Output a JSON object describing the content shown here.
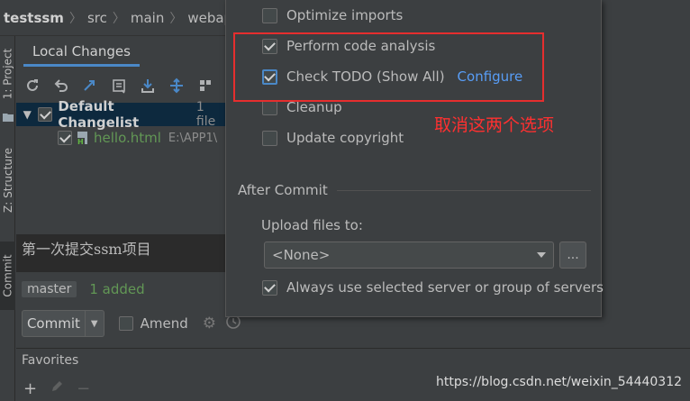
{
  "breadcrumb": [
    "testssm",
    "src",
    "main",
    "webapp"
  ],
  "side_tabs": {
    "project": "1: Project",
    "structure": "Z: Structure",
    "commit": "Commit"
  },
  "commit_panel": {
    "tab": "Local Changes",
    "changelist": {
      "name": "Default Changelist",
      "count": "1 file"
    },
    "file": {
      "name": "hello.html",
      "path": "E:\\APP1\\"
    },
    "message": "第一次提交ssm项目",
    "branch": "master",
    "added": "1 added",
    "commit_label": "Commit",
    "amend_label": "Amend"
  },
  "popup": {
    "options": [
      {
        "label": "Optimize imports",
        "checked": false
      },
      {
        "label": "Perform code analysis",
        "checked": true
      },
      {
        "label": "Check TODO (Show All)",
        "checked": true,
        "link": "Configure"
      },
      {
        "label": "Cleanup",
        "checked": false
      },
      {
        "label": "Update copyright",
        "checked": false
      }
    ],
    "after_commit": "After Commit",
    "upload_label": "Upload files to:",
    "server_value": "<None>",
    "dots": "...",
    "always_label": "Always use selected server or group of servers"
  },
  "favorites": {
    "title": "Favorites"
  },
  "annotation": "取消这两个选项",
  "watermark": "https://blog.csdn.net/weixin_54440312",
  "colors": {
    "accent": "#4a88c7",
    "annotation": "#ff3030",
    "added": "#629755",
    "link": "#589df6"
  }
}
